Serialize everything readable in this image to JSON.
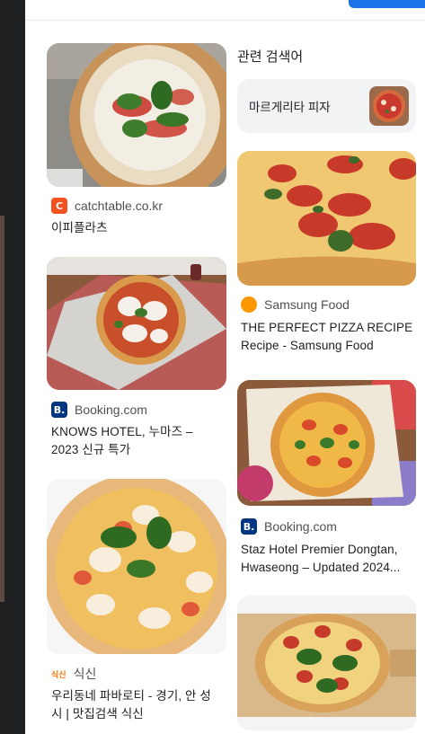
{
  "related": {
    "heading": "관련 검색어",
    "chips": [
      {
        "label": "마르게리타 피자",
        "thumb_icon": "pizza-thumbnail"
      }
    ]
  },
  "results": [
    {
      "source": "catchtable.co.kr",
      "favicon": "C",
      "favicon_color": "#f4511e",
      "title": "이피플라츠"
    },
    {
      "source": "Booking.com",
      "favicon": "B.",
      "favicon_color": "#003580",
      "title": "KNOWS HOTEL, 누마즈 – 2023 신규 특가"
    },
    {
      "source": "식신",
      "favicon": "식신",
      "favicon_color": "#ff6f00",
      "title": "우리동네 파바로티 - 경기, 안 성시 | 맛집검색 식신"
    },
    {
      "source": "Samsung Food",
      "favicon": "",
      "favicon_color": "#ff9800",
      "title": "THE PERFECT PIZZA RECIPE Recipe - Samsung Food"
    },
    {
      "source": "Booking.com",
      "favicon": "B.",
      "favicon_color": "#003580",
      "title": "Staz Hotel Premier Dongtan, Hwaseong – Updated 2024..."
    }
  ]
}
